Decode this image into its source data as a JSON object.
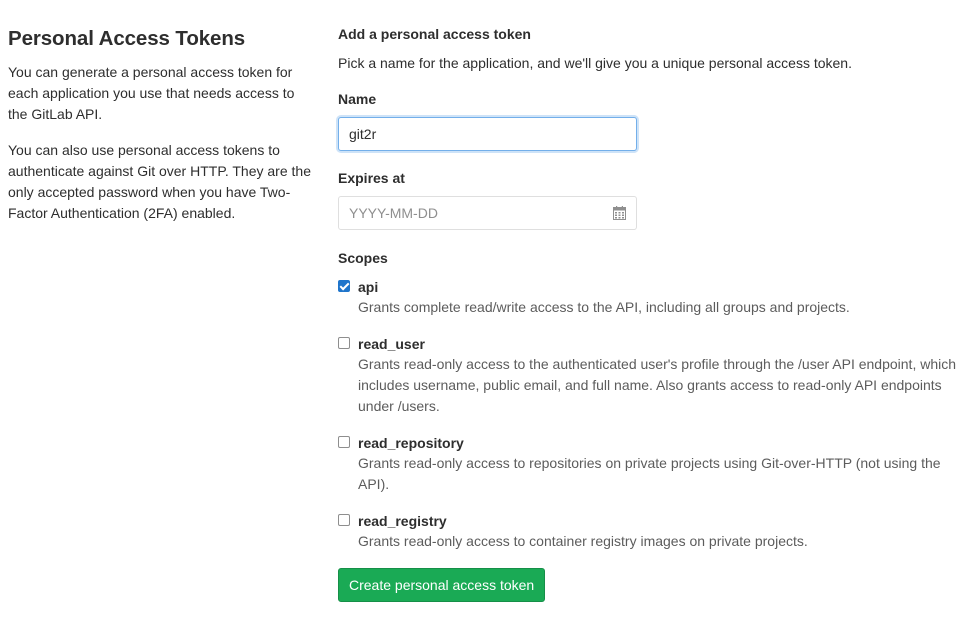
{
  "sidebar": {
    "title": "Personal Access Tokens",
    "paragraph1": "You can generate a personal access token for each application you use that needs access to the GitLab API.",
    "paragraph2": "You can also use personal access tokens to authenticate against Git over HTTP. They are the only accepted password when you have Two-Factor Authentication (2FA) enabled."
  },
  "form": {
    "heading": "Add a personal access token",
    "description": "Pick a name for the application, and we'll give you a unique personal access token.",
    "name_label": "Name",
    "name_value": "git2r",
    "expires_label": "Expires at",
    "expires_placeholder": "YYYY-MM-DD",
    "expires_icon": "calendar-icon",
    "scopes_label": "Scopes",
    "scopes": [
      {
        "name": "api",
        "checked": true,
        "description": "Grants complete read/write access to the API, including all groups and projects."
      },
      {
        "name": "read_user",
        "checked": false,
        "description": "Grants read-only access to the authenticated user's profile through the /user API endpoint, which includes username, public email, and full name. Also grants access to read-only API endpoints under /users."
      },
      {
        "name": "read_repository",
        "checked": false,
        "description": "Grants read-only access to repositories on private projects using Git-over-HTTP (not using the API)."
      },
      {
        "name": "read_registry",
        "checked": false,
        "description": "Grants read-only access to container registry images on private projects."
      }
    ],
    "submit_label": "Create personal access token"
  },
  "colors": {
    "accent_blue": "#1f75cb",
    "focus_border": "#73afea",
    "button_green": "#1aaa55"
  }
}
